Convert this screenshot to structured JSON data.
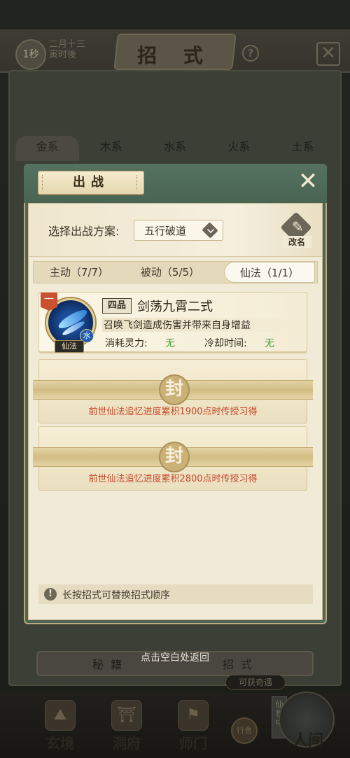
{
  "background": {
    "title": "招  式",
    "timer": "1秒",
    "date_line1": "二月十三",
    "date_line2": "寅时後",
    "help": "?",
    "close": "✕",
    "element_tabs": [
      "金系",
      "木系",
      "水系",
      "火系",
      "土系"
    ],
    "bottom_tab_left": "秘籍",
    "bottom_tab_right": "招式",
    "chance_label": "可获奇遇"
  },
  "nav": {
    "items": [
      {
        "label": "玄境",
        "icon": "realm-icon"
      },
      {
        "label": "洞府",
        "icon": "cave-icon"
      },
      {
        "label": "师门",
        "icon": "sect-icon"
      }
    ],
    "mail_label": "行舍",
    "side_badge": "仙世中",
    "world_label": "人间"
  },
  "modal": {
    "title": "出战",
    "close_icon": "✕",
    "scheme_label": "选择出战方案:",
    "scheme_value": "五行破道",
    "rename_label": "改名",
    "tabs": [
      {
        "label": "主动（7/7）",
        "active": false
      },
      {
        "label": "被动（5/5）",
        "active": false
      },
      {
        "label": "仙法（1/1）",
        "active": true
      }
    ],
    "skill": {
      "rank_badge": "一",
      "element": "水",
      "type": "仙法",
      "grade": "四品",
      "name": "剑荡九霄二式",
      "description": "召唤飞剑造成伤害并带来自身增益",
      "cost_label": "消耗灵力:",
      "cost_value": "无",
      "cooldown_label": "冷却时间:",
      "cooldown_value": "无"
    },
    "locked_slots": [
      {
        "seal": "封",
        "text": "前世仙法追忆进度累积1900点时传授习得"
      },
      {
        "seal": "封",
        "text": "前世仙法追忆进度累积2800点时传授习得"
      }
    ],
    "hint_icon": "!",
    "hint": "长按招式可替换招式顺序"
  },
  "close_hint": "点击空白处返回",
  "colors": {
    "modal_green": "#4f6657",
    "parchment": "#f1ead6",
    "free_value": "#3f9a35",
    "locked_text": "#c44a2a"
  }
}
